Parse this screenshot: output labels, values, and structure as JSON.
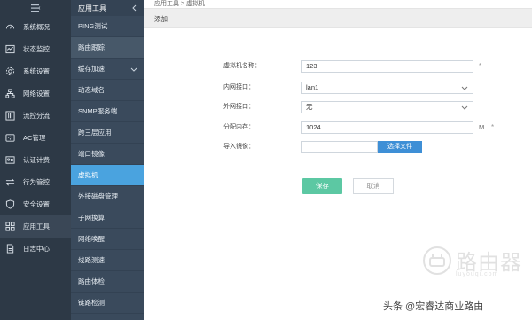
{
  "breadcrumb": "应用工具 > 虚拟机",
  "toolbar": {
    "add_label": "添加"
  },
  "nav1": {
    "items": [
      {
        "label": "系统概况",
        "icon": "dashboard-icon"
      },
      {
        "label": "状态监控",
        "icon": "monitor-icon"
      },
      {
        "label": "系统设置",
        "icon": "gear-icon"
      },
      {
        "label": "网络设置",
        "icon": "network-icon"
      },
      {
        "label": "流控分流",
        "icon": "flow-icon"
      },
      {
        "label": "AC管理",
        "icon": "wifi-icon"
      },
      {
        "label": "认证计费",
        "icon": "id-card-icon"
      },
      {
        "label": "行为管控",
        "icon": "arrows-icon"
      },
      {
        "label": "安全设置",
        "icon": "shield-icon"
      },
      {
        "label": "应用工具",
        "icon": "apps-icon"
      },
      {
        "label": "日志中心",
        "icon": "document-icon"
      }
    ],
    "active_index": 9
  },
  "nav2": {
    "title": "应用工具",
    "items": [
      {
        "label": "PING测试"
      },
      {
        "label": "路由跟踪"
      },
      {
        "label": "缓存加速"
      },
      {
        "label": "动态域名"
      },
      {
        "label": "SNMP服务端"
      },
      {
        "label": "跨三层应用"
      },
      {
        "label": "端口镜像"
      },
      {
        "label": "虚拟机"
      },
      {
        "label": "外接磁盘管理"
      },
      {
        "label": "子网换算"
      },
      {
        "label": "网络唤醒"
      },
      {
        "label": "线路测速"
      },
      {
        "label": "路由体检"
      },
      {
        "label": "链路检测"
      }
    ]
  },
  "form": {
    "vm_name": {
      "label": "虚拟机名称：",
      "value": "123",
      "required": "*"
    },
    "lan_port": {
      "label": "内网接口：",
      "value": "lan1"
    },
    "wan_port": {
      "label": "外网接口：",
      "value": "无"
    },
    "memory": {
      "label": "分配内存：",
      "value": "1024",
      "unit": "M",
      "required": "*"
    },
    "image": {
      "label": "导入镜像：",
      "button": "选择文件"
    }
  },
  "buttons": {
    "save": "保存",
    "cancel": "取消"
  },
  "watermark": "头条 @宏睿达商业路由",
  "colors": {
    "nav_bg": "#2d3946",
    "accent": "#4aa3df",
    "save": "#5cc8a3",
    "file_btn": "#3e8fd6"
  }
}
